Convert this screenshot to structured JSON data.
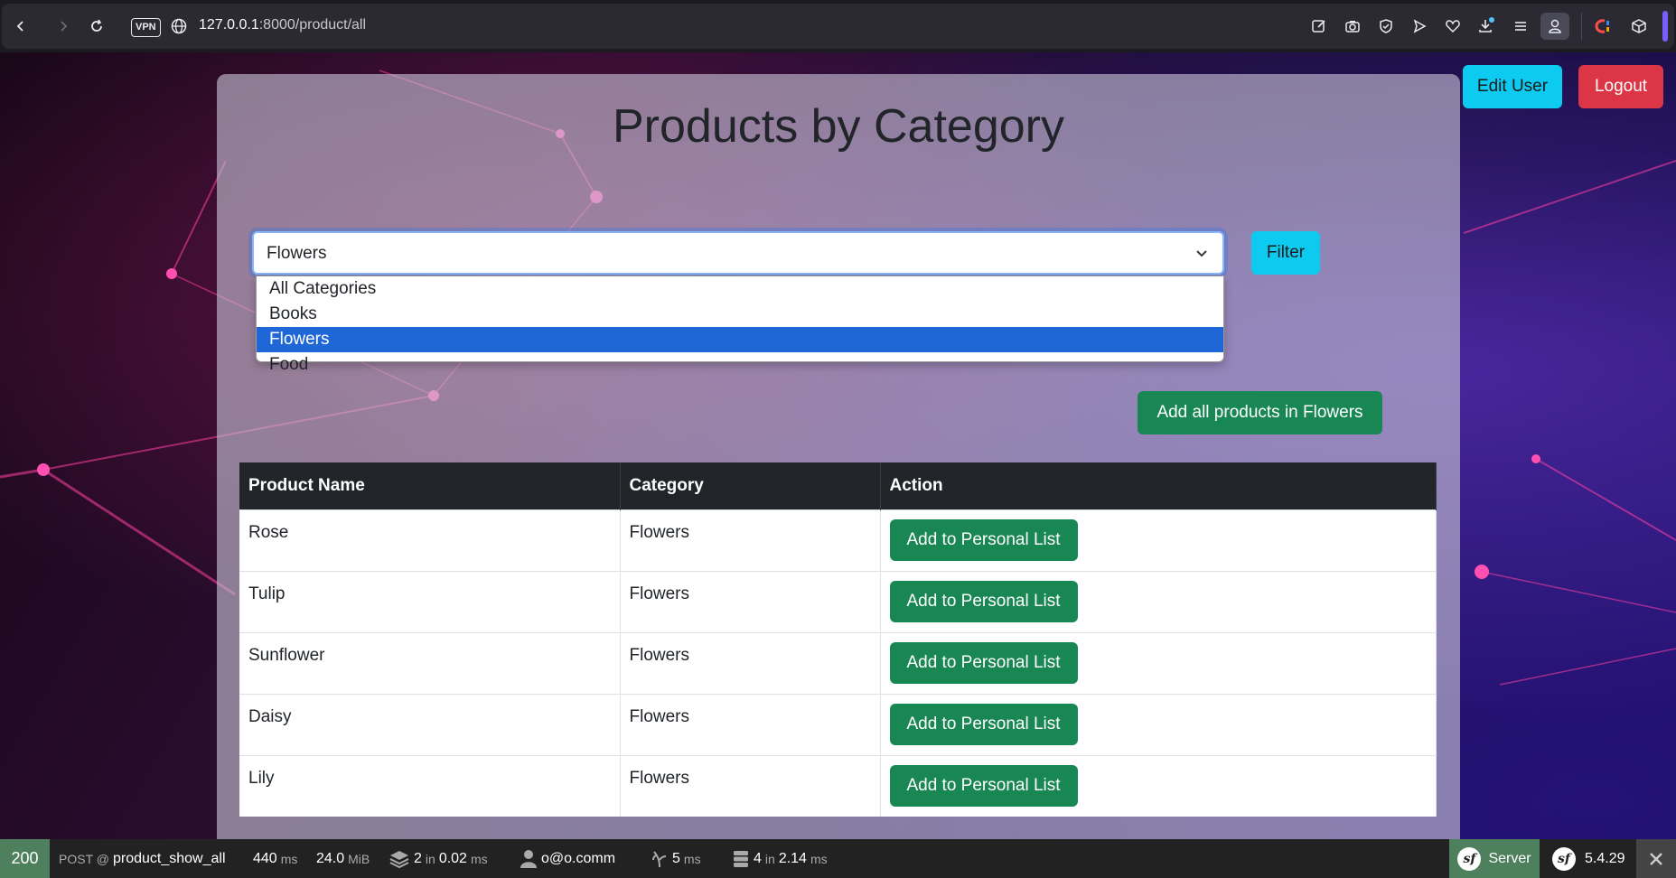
{
  "browser": {
    "vpn_label": "VPN",
    "url_host": "127.0.0.1",
    "url_path": ":8000/product/all"
  },
  "header": {
    "edit_user_label": "Edit User",
    "logout_label": "Logout"
  },
  "main": {
    "title": "Products by Category",
    "category_select": {
      "selected": "Flowers",
      "options": [
        "All Categories",
        "Books",
        "Flowers",
        "Food"
      ]
    },
    "filter_label": "Filter",
    "add_all_label": "Add all products in Flowers",
    "table": {
      "headers": [
        "Product Name",
        "Category",
        "Action"
      ],
      "rows": [
        {
          "name": "Rose",
          "category": "Flowers",
          "action": "Add to Personal List"
        },
        {
          "name": "Tulip",
          "category": "Flowers",
          "action": "Add to Personal List"
        },
        {
          "name": "Sunflower",
          "category": "Flowers",
          "action": "Add to Personal List"
        },
        {
          "name": "Daisy",
          "category": "Flowers",
          "action": "Add to Personal List"
        },
        {
          "name": "Lily",
          "category": "Flowers",
          "action": "Add to Personal List"
        }
      ]
    }
  },
  "debug_toolbar": {
    "status_code": "200",
    "method": "POST @",
    "route": "product_show_all",
    "time_value": "440",
    "time_unit": "ms",
    "memory_value": "24.0",
    "memory_unit": "MiB",
    "cache_count": "2",
    "cache_in": "in",
    "cache_time": "0.02",
    "cache_unit": "ms",
    "user": "o@o.comm",
    "twig_time": "5",
    "twig_unit": "ms",
    "db_count": "4",
    "db_in": "in",
    "db_time": "2.14",
    "db_unit": "ms",
    "server_label": "Server",
    "version": "5.4.29"
  },
  "colors": {
    "primary_info": "#0dcaf0",
    "danger": "#dc3545",
    "success": "#198754",
    "table_header": "#212529",
    "selected_option": "#1f66d6"
  }
}
